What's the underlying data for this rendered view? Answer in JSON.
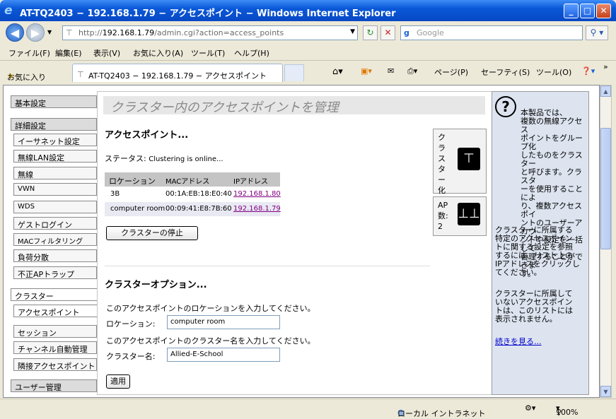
{
  "window": {
    "title": "AT-TQ2403 − 192.168.1.79 − アクセスポイント − Windows Internet Explorer"
  },
  "address": {
    "url_prefix": "http://",
    "url_host": "192.168.1.79",
    "url_path": "/admin.cgi?action=access_points"
  },
  "search": {
    "placeholder": "Google"
  },
  "menu": [
    "ファイル(F)",
    "編集(E)",
    "表示(V)",
    "お気に入り(A)",
    "ツール(T)",
    "ヘルプ(H)"
  ],
  "favorites": {
    "label": "お気に入り"
  },
  "tab": {
    "title": "AT-TQ2403 − 192.168.1.79 − アクセスポイント"
  },
  "toolbar": {
    "page": "ページ(P)",
    "safety": "セーフティ(S)",
    "tools": "ツール(O)"
  },
  "sidebar": {
    "basic": "基本設定",
    "advanced": "詳細設定",
    "ethernet": "イーサネット設定",
    "wlan": "無線LAN設定",
    "wireless": "無線",
    "vwn": "VWN",
    "wds": "WDS",
    "guest": "ゲストログイン",
    "mac": "MACフィルタリング",
    "load": "負荷分散",
    "rogue": "不正APトラップ",
    "cluster": "クラスター",
    "ap": "アクセスポイント",
    "session": "セッション",
    "channel": "チャンネル自動管理",
    "neighbor": "隣接アクセスポイント",
    "users": "ユーザー管理"
  },
  "main": {
    "title": "クラスター内のアクセスポイントを管理",
    "ap_heading": "アクセスポイント...",
    "status_label": "ステータス:",
    "status_value": "Clustering is online...",
    "columns": [
      "ロケーション",
      "MACアドレス",
      "IPアドレス"
    ],
    "rows": [
      {
        "location": "3B",
        "mac": "00:1A:EB:18:E0:40",
        "ip": "192.168.1.80"
      },
      {
        "location": "computer room",
        "mac": "00:09:41:E8:7B:60",
        "ip": "192.168.1.79"
      }
    ],
    "stop_button": "クラスターの停止",
    "options_heading": "クラスターオプション...",
    "loc_instruction": "このアクセスポイントのロケーションを入力してください。",
    "loc_label": "ロケーション:",
    "loc_value": "computer room",
    "name_instruction": "このアクセスポイントのクラスター名を入力してください。",
    "name_label": "クラスター名:",
    "name_value": "Allied-E-School",
    "apply_button": "適用"
  },
  "cards": {
    "cluster": "クラスター化",
    "ap_count_label": "AP数:",
    "ap_count": "2"
  },
  "help": {
    "p1": "本製品では、\n複数の無線アクセス\nポイントをグループ化\nしたものをクラスター\nと呼びます。クラスタ\nーを使用することによ\nり、複数アクセスポイ\nントのユーザーアカウ\nントや設定を一括して\n管理することができま\nす。",
    "p2": "クラスターに所属する\n特定のアクセスポイン\nトに関する設定を参照\nするには、リスト上の\nIPアドレスをクリックし\nてください。",
    "p3": "クラスターに所属して\nいないアクセスポイン\nトは、このリストには\n表示されません。",
    "more": "続きを見る..."
  },
  "status": {
    "zone": "ローカル イントラネット",
    "zoom": "100%"
  }
}
